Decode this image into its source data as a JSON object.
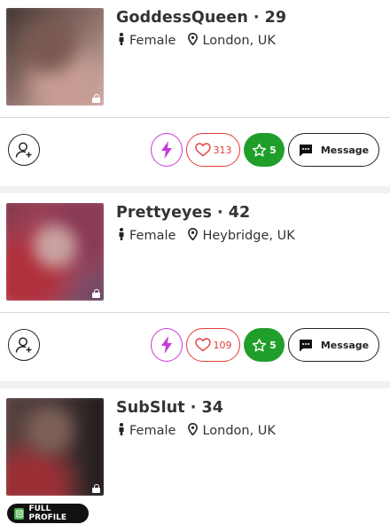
{
  "profiles": [
    {
      "name": "GoddessQueen",
      "sep": "·",
      "age": "29",
      "gender": "Female",
      "location": "London, UK",
      "likes": "313",
      "favourites": "5",
      "message_label": "Message"
    },
    {
      "name": "Prettyeyes",
      "sep": "·",
      "age": "42",
      "gender": "Female",
      "location": "Heybridge, UK",
      "likes": "109",
      "favourites": "5",
      "message_label": "Message"
    },
    {
      "name": "SubSlut",
      "sep": "·",
      "age": "34",
      "gender": "Female",
      "location": "London, UK",
      "full_profile_label": "FULL PROFILE"
    }
  ],
  "colors": {
    "boost": "#c63bd8",
    "like": "#e23b3b",
    "favourite": "#1f9f2a",
    "badge": "#4caf50"
  },
  "icons": [
    "person-icon",
    "map-pin-icon",
    "lock-icon",
    "add-friend-icon",
    "lightning-icon",
    "heart-icon",
    "star-icon",
    "chat-bubble-icon",
    "profile-badge-icon"
  ]
}
